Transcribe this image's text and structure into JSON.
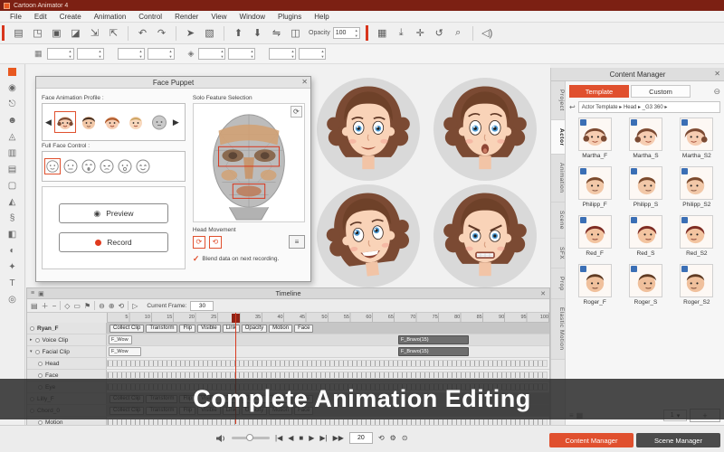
{
  "titlebar": {
    "app_title": "Cartoon Animator 4"
  },
  "menubar": {
    "items": [
      "File",
      "Edit",
      "Create",
      "Animation",
      "Control",
      "Render",
      "View",
      "Window",
      "Plugins",
      "Help"
    ]
  },
  "toolbar": {
    "opacity_label": "Opacity",
    "opacity_value": "100"
  },
  "face_puppet": {
    "title": "Face Puppet",
    "profile_label": "Face Animation Profile :",
    "solo_label": "Solo Feature Selection",
    "full_face_label": "Full Face Control :",
    "preview_label": "Preview",
    "record_label": "Record",
    "head_movement_label": "Head Movement",
    "blend_label": "Blend data on next recording."
  },
  "content_manager": {
    "title": "Content Manager",
    "tabs": {
      "template": "Template",
      "custom": "Custom"
    },
    "breadcrumb": "Actor Template ▸   Head ▸   _G3 360 ▸",
    "side_tabs": [
      "Project",
      "Actor",
      "Animation",
      "Scene",
      "SFX",
      "Prop",
      "Elastic Motion"
    ],
    "items": [
      {
        "label": "Martha_F"
      },
      {
        "label": "Martha_S"
      },
      {
        "label": "Martha_S2"
      },
      {
        "label": "Philipp_F"
      },
      {
        "label": "Philipp_S"
      },
      {
        "label": "Philipp_S2"
      },
      {
        "label": "Red_F"
      },
      {
        "label": "Red_S"
      },
      {
        "label": "Red_S2"
      },
      {
        "label": "Roger_F"
      },
      {
        "label": "Roger_S"
      },
      {
        "label": "Roger_S2"
      }
    ],
    "page_number": "1",
    "add_label": "+"
  },
  "timeline": {
    "title": "Timeline",
    "current_frame_label": "Current Frame:",
    "current_frame_value": "30",
    "ruler": [
      "5",
      "10",
      "15",
      "20",
      "25",
      "30",
      "35",
      "40",
      "45",
      "50",
      "55",
      "60",
      "65",
      "70",
      "75",
      "80",
      "85",
      "90",
      "95",
      "100"
    ],
    "row_buttons": [
      "Collect Clip",
      "Transform",
      "Flip",
      "Visible",
      "Link",
      "Opacity",
      "Motion",
      "Face"
    ],
    "tracks": [
      {
        "name": "Ryan_F"
      },
      {
        "name": "Voice Clip",
        "clip1": "F_Wow",
        "clip2": "F_Bravo(15)"
      },
      {
        "name": "Facial Clip",
        "clip1": "F_Wow",
        "clip2": "F_Bravo(15)"
      },
      {
        "name": "Head"
      },
      {
        "name": "Face"
      },
      {
        "name": "Eye"
      },
      {
        "name": "Lilly_F"
      },
      {
        "name": "Chord_0"
      },
      {
        "name": "Motion"
      }
    ]
  },
  "banner": {
    "text": "Complete Animation Editing"
  },
  "statusbar": {
    "frame_value": "20",
    "content_manager_button": "Content Manager",
    "scene_manager_button": "Scene Manager"
  },
  "colors": {
    "accent": "#e0502e",
    "titlebar": "#7c2013",
    "banner_bg": "#2a2a2a",
    "badge_blue": "#3b6fb5"
  }
}
